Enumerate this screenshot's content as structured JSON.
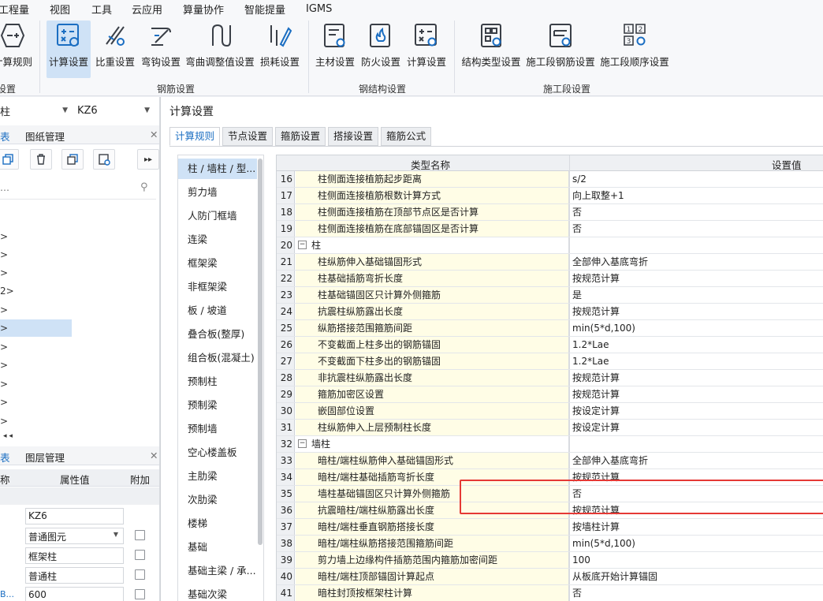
{
  "menu": [
    "工程量",
    "视图",
    "工具",
    "云应用",
    "算量协作",
    "智能提量",
    "IGMS"
  ],
  "ribbon": {
    "buttons": [
      {
        "label": "计算规则",
        "icon": "calc-rule-icon"
      },
      {
        "label": "计算设置",
        "icon": "calc-settings-icon"
      },
      {
        "label": "比重设置",
        "icon": "density-settings-icon"
      },
      {
        "label": "弯钩设置",
        "icon": "hook-settings-icon"
      },
      {
        "label": "弯曲调整值设置",
        "icon": "bend-adjust-icon"
      },
      {
        "label": "损耗设置",
        "icon": "loss-settings-icon"
      },
      {
        "label": "主材设置",
        "icon": "main-material-icon"
      },
      {
        "label": "防火设置",
        "icon": "fireproof-icon"
      },
      {
        "label": "计算设置",
        "icon": "steel-calc-settings-icon"
      },
      {
        "label": "结构类型设置",
        "icon": "structure-type-icon"
      },
      {
        "label": "施工段钢筋设置",
        "icon": "segment-rebar-icon"
      },
      {
        "label": "施工段顺序设置",
        "icon": "segment-order-icon"
      }
    ],
    "groups": [
      "设置",
      "钢筋设置",
      "钢结构设置",
      "施工段设置"
    ]
  },
  "left_panel": {
    "combo1": "柱",
    "combo2": "KZ6",
    "tabs": [
      "表",
      "图纸管理"
    ],
    "tree_suffixes": [
      ">",
      ">",
      ">",
      "2>",
      ">",
      ">",
      ">",
      ">",
      ">",
      ">",
      ">"
    ],
    "tree_tail": "◂ ◂",
    "tabs2": [
      "表",
      "图层管理"
    ],
    "prop_headers": [
      "称",
      "属性值",
      "附加"
    ],
    "props": [
      {
        "key": "",
        "value": "KZ6",
        "has_check": false
      },
      {
        "key": "",
        "value": "普通图元",
        "has_check": true,
        "dropdown": true
      },
      {
        "key": "",
        "value": "框架柱",
        "has_check": true
      },
      {
        "key": "",
        "value": "普通柱",
        "has_check": true
      },
      {
        "key": "B...",
        "value": "600",
        "has_check": true
      }
    ]
  },
  "dialog": {
    "title": "计算设置",
    "tabs": [
      "计算规则",
      "节点设置",
      "箍筋设置",
      "搭接设置",
      "箍筋公式"
    ],
    "categories": [
      "柱 / 墙柱 / 型...",
      "剪力墙",
      "人防门框墙",
      "连梁",
      "框架梁",
      "非框架梁",
      "板 / 坡道",
      "叠合板(整厚)",
      "组合板(混凝土)",
      "预制柱",
      "预制梁",
      "预制墙",
      "空心楼盖板",
      "主肋梁",
      "次肋梁",
      "楼梯",
      "基础",
      "基础主梁 / 承...",
      "基础次梁"
    ],
    "grid_headers": [
      "类型名称",
      "设置值"
    ],
    "rows": [
      {
        "n": "16",
        "name": "柱侧面连接植筋起步距离",
        "value": "s/2"
      },
      {
        "n": "17",
        "name": "柱侧面连接植筋根数计算方式",
        "value": "向上取整+1"
      },
      {
        "n": "18",
        "name": "柱侧面连接植筋在顶部节点区是否计算",
        "value": "否"
      },
      {
        "n": "19",
        "name": "柱侧面连接植筋在底部锚固区是否计算",
        "value": "否"
      },
      {
        "n": "20",
        "name": "柱",
        "value": "",
        "group": true
      },
      {
        "n": "21",
        "name": "柱纵筋伸入基础锚固形式",
        "value": "全部伸入基底弯折"
      },
      {
        "n": "22",
        "name": "柱基础插筋弯折长度",
        "value": "按规范计算"
      },
      {
        "n": "23",
        "name": "柱基础锚固区只计算外侧箍筋",
        "value": "是"
      },
      {
        "n": "24",
        "name": "抗震柱纵筋露出长度",
        "value": "按规范计算"
      },
      {
        "n": "25",
        "name": "纵筋搭接范围箍筋间距",
        "value": "min(5*d,100)"
      },
      {
        "n": "26",
        "name": "不变截面上柱多出的钢筋锚固",
        "value": "1.2*Lae"
      },
      {
        "n": "27",
        "name": "不变截面下柱多出的钢筋锚固",
        "value": "1.2*Lae"
      },
      {
        "n": "28",
        "name": "非抗震柱纵筋露出长度",
        "value": "按规范计算"
      },
      {
        "n": "29",
        "name": "箍筋加密区设置",
        "value": "按规范计算"
      },
      {
        "n": "30",
        "name": "嵌固部位设置",
        "value": "按设定计算"
      },
      {
        "n": "31",
        "name": "柱纵筋伸入上层预制柱长度",
        "value": "按设定计算"
      },
      {
        "n": "32",
        "name": "墙柱",
        "value": "",
        "group": true
      },
      {
        "n": "33",
        "name": "暗柱/端柱纵筋伸入基础锚固形式",
        "value": "全部伸入基底弯折"
      },
      {
        "n": "34",
        "name": "暗柱/端柱基础插筋弯折长度",
        "value": "按规范计算"
      },
      {
        "n": "35",
        "name": "墙柱基础锚固区只计算外侧箍筋",
        "value": "否"
      },
      {
        "n": "36",
        "name": "抗震暗柱/端柱纵筋露出长度",
        "value": "按规范计算"
      },
      {
        "n": "37",
        "name": "暗柱/端柱垂直钢筋搭接长度",
        "value": "按墙柱计算"
      },
      {
        "n": "38",
        "name": "暗柱/端柱纵筋搭接范围箍筋间距",
        "value": "min(5*d,100)"
      },
      {
        "n": "39",
        "name": "剪力墙上边缘构件插筋范围内箍筋加密间距",
        "value": "100"
      },
      {
        "n": "40",
        "name": "暗柱/端柱顶部锚固计算起点",
        "value": "从板底开始计算锚固"
      },
      {
        "n": "41",
        "name": "暗柱封顶按框架柱计算",
        "value": "否"
      }
    ]
  },
  "colors": {
    "accent": "#1b6ec2",
    "selection": "#cfe2f6",
    "highlight": "#e53935",
    "name_cell": "#fffde6"
  }
}
